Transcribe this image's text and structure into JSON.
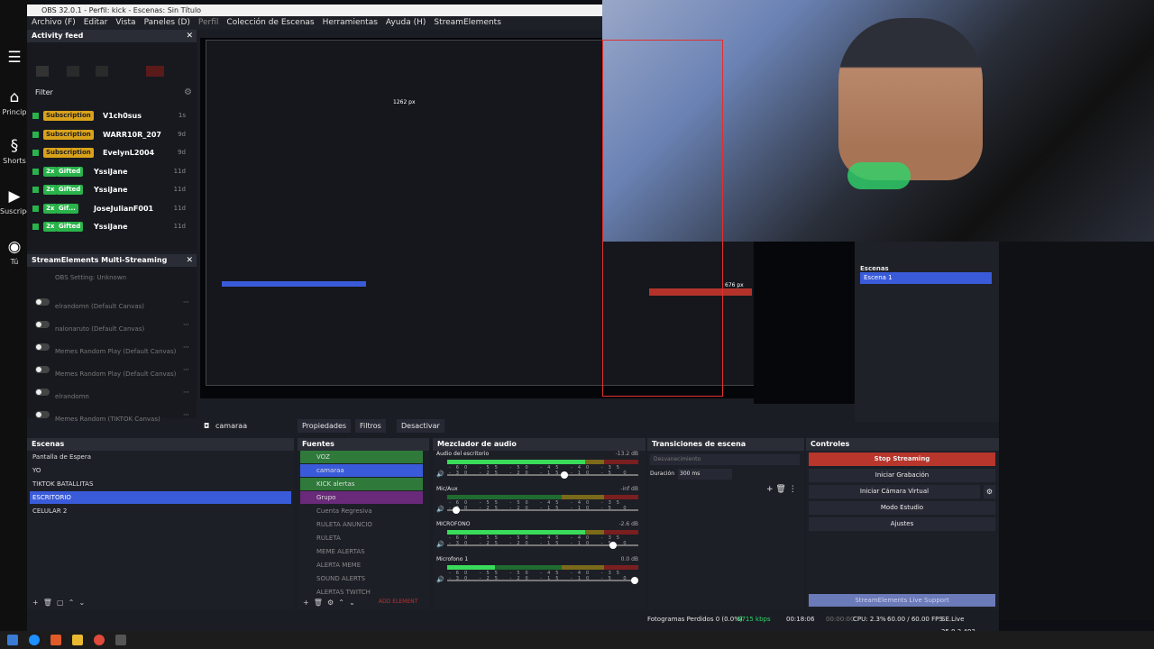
{
  "window": {
    "title": "OBS 32.0.1 - Perfil: kick - Escenas: Sin Título"
  },
  "menu": [
    "Archivo (F)",
    "Editar",
    "Vista",
    "Paneles (D)",
    "Perfil",
    "Colección de Escenas",
    "Herramientas",
    "Ayuda (H)",
    "StreamElements"
  ],
  "youtube": {
    "items": [
      {
        "icon": "home-icon",
        "label": "Princip"
      },
      {
        "icon": "shorts-icon",
        "label": "Shorts"
      },
      {
        "icon": "subscriptions-icon",
        "label": "Suscripcion"
      },
      {
        "icon": "user-icon",
        "label": "Tú"
      }
    ]
  },
  "activity_feed": {
    "title": "Activity feed",
    "filter": "Filter",
    "rows": [
      {
        "type": "Subscription",
        "name": "V1ch0sus",
        "time": "1s"
      },
      {
        "type": "Subscription",
        "name": "WARR10R_207",
        "time": "9d"
      },
      {
        "type": "Subscription",
        "name": "EvelynL2004",
        "time": "9d"
      },
      {
        "count": "2x",
        "type": "Gifted",
        "name": "YssiJane",
        "time": "11d"
      },
      {
        "count": "2x",
        "type": "Gifted",
        "name": "YssiJane",
        "time": "11d"
      },
      {
        "count": "2x",
        "type": "Gif...",
        "name": "JoseJulianF001",
        "time": "11d"
      },
      {
        "count": "2x",
        "type": "Gifted",
        "name": "YssiJane",
        "time": "11d"
      }
    ]
  },
  "multistream": {
    "title": "StreamElements Multi-Streaming",
    "rows": [
      "OBS Setting: Unknown",
      "elrandomn (Default Canvas)",
      "nalonaruto (Default Canvas)",
      "Memes Random Play (Default Canvas)",
      "Memes Random Play (Default Canvas)",
      "elrandomn",
      "Memes Random (TIKTOK Canvas)"
    ]
  },
  "preview_toolbar": {
    "source": "camaraa",
    "properties": "Propiedades",
    "filters": "Filtros",
    "deactivate": "Desactivar"
  },
  "preview_labels": {
    "px1": "1262 px",
    "px2": "676 px"
  },
  "right_scenes": {
    "title": "Escenas",
    "selected": "Escena 1"
  },
  "scenes": {
    "title": "Escenas",
    "items": [
      "Pantalla de Espera",
      "YO",
      "TIKTOK BATALLITAS",
      "ESCRITORIO",
      "CELULAR 2"
    ],
    "selected": 3
  },
  "sources": {
    "title": "Fuentes",
    "items": [
      "VOZ",
      "camaraa",
      "KICK alertas",
      "Grupo",
      "Cuenta Regresiva",
      "RULETA ANUNCIO",
      "RULETA",
      "MEME ALERTAS",
      "ALERTA MEME",
      "SOUND ALERTS",
      "ALERTAS TWITCH"
    ],
    "add": "ADD ELEMENT"
  },
  "mixer": {
    "title": "Mezclador de audio",
    "channels": [
      {
        "name": "Audio del escritorio",
        "db": "-13.2 dB",
        "level": 0.72,
        "vol": 0.62
      },
      {
        "name": "Mic/Aux",
        "db": "-inf dB",
        "level": 0,
        "vol": 0.03
      },
      {
        "name": "MICROFONO",
        "db": "-2.6 dB",
        "level": 0.72,
        "vol": 0.88
      },
      {
        "name": "Microfono 1",
        "db": "0.0 dB",
        "level": 0.25,
        "vol": 1.0
      }
    ],
    "ticks": "-60 -55 -50 -45 -40 -35 -30 -25 -20 -15 -10 -5 0"
  },
  "transitions": {
    "title": "Transiciones de escena",
    "type": "Desvanecimiento",
    "duration_label": "Duración",
    "duration": "300 ms"
  },
  "controls": {
    "title": "Controles",
    "buttons": [
      "Stop Streaming",
      "Iniciar Grabación",
      "Iniciar Cámara Virtual",
      "Modo Estudio",
      "Ajustes"
    ],
    "support": "StreamElements Live Support"
  },
  "status": {
    "dropped": "Fotogramas Perdidos 0 (0.0%)",
    "kbps": "6715 kbps",
    "time": "00:18:06",
    "rec": "00:00:00",
    "cpu": "CPU: 2.3%",
    "fps": "60.00 / 60.00 FPS",
    "version": "SE.Live 25.9.3.493"
  },
  "colors": {
    "accent": "#3a5bd9",
    "stop": "#c0392b",
    "green": "#29b34a",
    "gold": "#d9a21b"
  }
}
